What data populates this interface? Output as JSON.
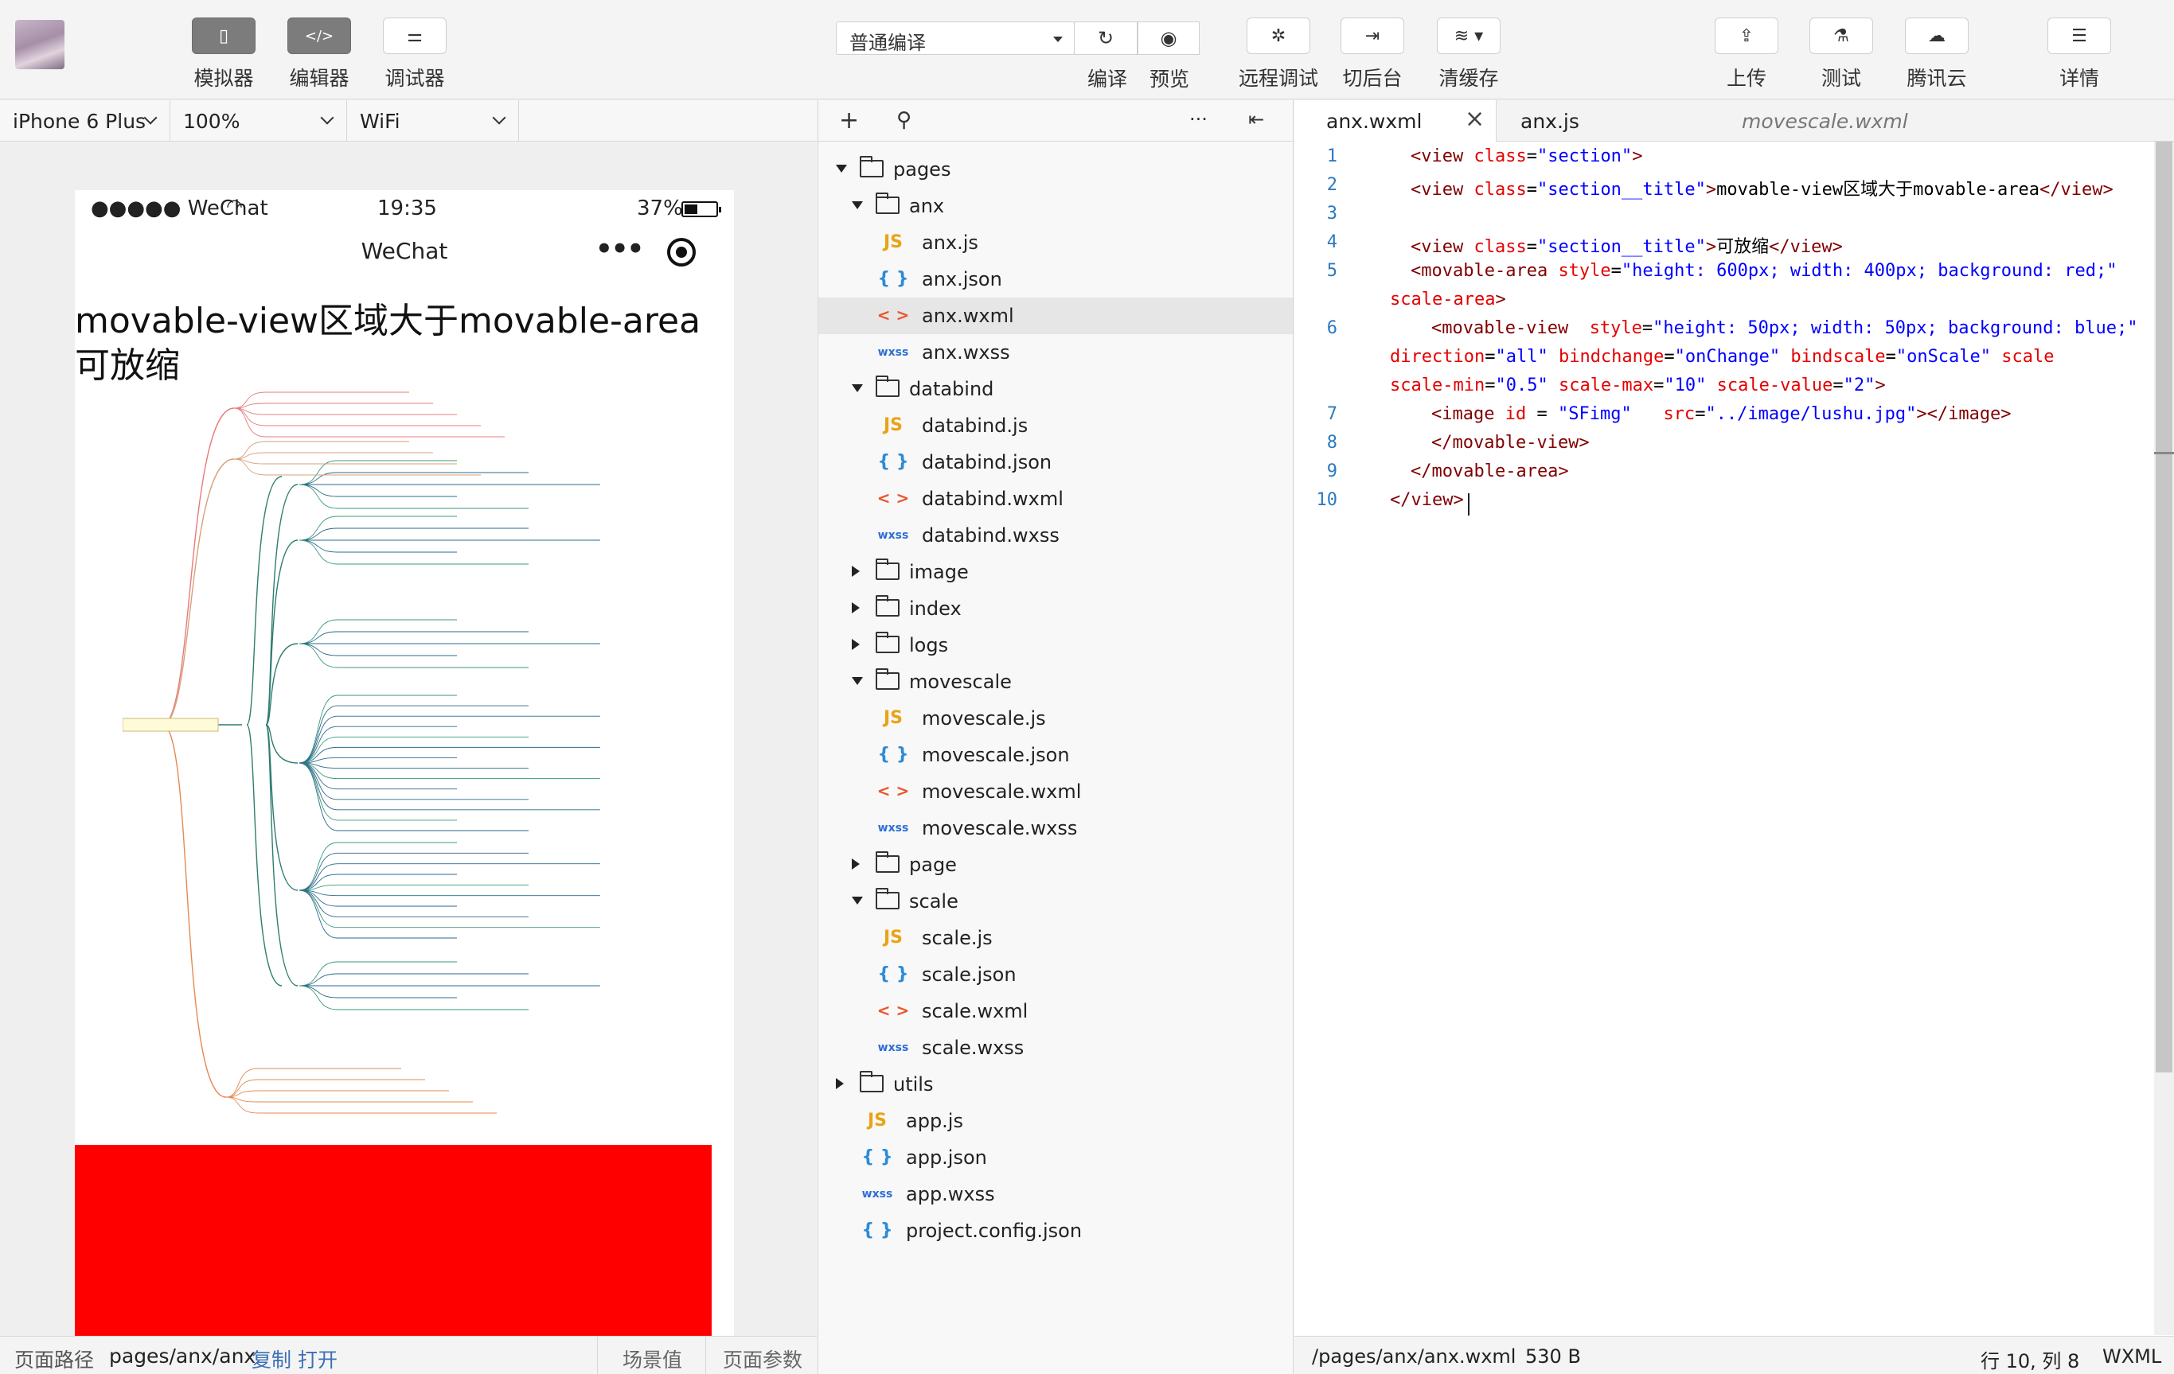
{
  "toolbar": {
    "simulator_label": "模拟器",
    "editor_label": "编辑器",
    "debugger_label": "调试器",
    "compile_mode": "普通编译",
    "compile_label": "编译",
    "preview_label": "预览",
    "remote_debug_label": "远程调试",
    "background_label": "切后台",
    "clear_cache_label": "清缓存",
    "upload_label": "上传",
    "test_label": "测试",
    "tencent_cloud_label": "腾讯云",
    "details_label": "详情"
  },
  "device_bar": {
    "device": "iPhone 6 Plus",
    "zoom": "100%",
    "network": "WiFi"
  },
  "phone": {
    "signal": "●●●●● WeChat",
    "time": "19:35",
    "battery": "37%",
    "nav_title": "WeChat",
    "title_line1": "movable-view区域大于movable-area",
    "title_line2": "可放缩"
  },
  "sim_status": {
    "path_label": "页面路径",
    "path": "pages/anx/anx",
    "copy": "复制",
    "open": "打开",
    "scene": "场景值",
    "params": "页面参数"
  },
  "file_tree": {
    "rows": [
      {
        "label": "pages",
        "kind": "folder",
        "open": true,
        "depth": 0
      },
      {
        "label": "anx",
        "kind": "folder",
        "open": true,
        "depth": 1
      },
      {
        "label": "anx.js",
        "kind": "js",
        "depth": 2
      },
      {
        "label": "anx.json",
        "kind": "json",
        "depth": 2
      },
      {
        "label": "anx.wxml",
        "kind": "wxml",
        "depth": 2,
        "selected": true
      },
      {
        "label": "anx.wxss",
        "kind": "wxss",
        "depth": 2
      },
      {
        "label": "databind",
        "kind": "folder",
        "open": true,
        "depth": 1
      },
      {
        "label": "databind.js",
        "kind": "js",
        "depth": 2
      },
      {
        "label": "databind.json",
        "kind": "json",
        "depth": 2
      },
      {
        "label": "databind.wxml",
        "kind": "wxml",
        "depth": 2
      },
      {
        "label": "databind.wxss",
        "kind": "wxss",
        "depth": 2
      },
      {
        "label": "image",
        "kind": "folder",
        "open": false,
        "depth": 1
      },
      {
        "label": "index",
        "kind": "folder",
        "open": false,
        "depth": 1
      },
      {
        "label": "logs",
        "kind": "folder",
        "open": false,
        "depth": 1
      },
      {
        "label": "movescale",
        "kind": "folder",
        "open": true,
        "depth": 1
      },
      {
        "label": "movescale.js",
        "kind": "js",
        "depth": 2
      },
      {
        "label": "movescale.json",
        "kind": "json",
        "depth": 2
      },
      {
        "label": "movescale.wxml",
        "kind": "wxml",
        "depth": 2
      },
      {
        "label": "movescale.wxss",
        "kind": "wxss",
        "depth": 2
      },
      {
        "label": "page",
        "kind": "folder",
        "open": false,
        "depth": 1
      },
      {
        "label": "scale",
        "kind": "folder",
        "open": true,
        "depth": 1
      },
      {
        "label": "scale.js",
        "kind": "js",
        "depth": 2
      },
      {
        "label": "scale.json",
        "kind": "json",
        "depth": 2
      },
      {
        "label": "scale.wxml",
        "kind": "wxml",
        "depth": 2
      },
      {
        "label": "scale.wxss",
        "kind": "wxss",
        "depth": 2
      },
      {
        "label": "utils",
        "kind": "folder",
        "open": false,
        "depth": 0
      },
      {
        "label": "app.js",
        "kind": "js",
        "depth": 1
      },
      {
        "label": "app.json",
        "kind": "json",
        "depth": 1
      },
      {
        "label": "app.wxss",
        "kind": "wxss",
        "depth": 1
      },
      {
        "label": "project.config.json",
        "kind": "json",
        "depth": 1
      }
    ]
  },
  "editor": {
    "tabs": [
      {
        "label": "anx.wxml",
        "active": true
      },
      {
        "label": "anx.js",
        "active": false
      },
      {
        "label": "movescale.wxml",
        "active": false,
        "preview": true
      }
    ],
    "lines": [
      {
        "n": "1",
        "tokens": [
          [
            "t",
            "<view "
          ],
          [
            "a",
            "class"
          ],
          [
            "x",
            "="
          ],
          [
            "v",
            "\"section\""
          ],
          [
            "t",
            ">"
          ]
        ]
      },
      {
        "n": "2",
        "tokens": [
          [
            "t",
            "<view "
          ],
          [
            "a",
            "class"
          ],
          [
            "x",
            "="
          ],
          [
            "v",
            "\"section__title\""
          ],
          [
            "t",
            ">"
          ],
          [
            "x",
            "movable-view区域大于movable-area"
          ],
          [
            "t",
            "</view>"
          ]
        ]
      },
      {
        "n": "3",
        "tokens": []
      },
      {
        "n": "4",
        "tokens": [
          [
            "t",
            "<view "
          ],
          [
            "a",
            "class"
          ],
          [
            "x",
            "="
          ],
          [
            "v",
            "\"section__title\""
          ],
          [
            "t",
            ">"
          ],
          [
            "x",
            "可放缩"
          ],
          [
            "t",
            "</view>"
          ]
        ]
      },
      {
        "n": "5",
        "tokens": [
          [
            "t",
            "<movable-area "
          ],
          [
            "a",
            "style"
          ],
          [
            "x",
            "="
          ],
          [
            "v",
            "\"height: 600px; width: 400px; background: red;\""
          ]
        ],
        "wrap": [
          [
            "a",
            "scale-area"
          ],
          [
            "t",
            ">"
          ]
        ]
      },
      {
        "n": "6",
        "tokens": [
          [
            "t",
            "<movable-view  "
          ],
          [
            "a",
            "style"
          ],
          [
            "x",
            "="
          ],
          [
            "v",
            "\"height: 50px; width: 50px; background: blue;\""
          ]
        ],
        "wrap": [
          [
            "a",
            "direction"
          ],
          [
            "x",
            "="
          ],
          [
            "v",
            "\"all\" "
          ],
          [
            "a",
            "bindchange"
          ],
          [
            "x",
            "="
          ],
          [
            "v",
            "\"onChange\" "
          ],
          [
            "a",
            "bindscale"
          ],
          [
            "x",
            "="
          ],
          [
            "v",
            "\"onScale\" "
          ],
          [
            "a",
            "scale"
          ]
        ],
        "wrap2": [
          [
            "a",
            "scale-min"
          ],
          [
            "x",
            "="
          ],
          [
            "v",
            "\"0.5\" "
          ],
          [
            "a",
            "scale-max"
          ],
          [
            "x",
            "="
          ],
          [
            "v",
            "\"10\" "
          ],
          [
            "a",
            "scale-value"
          ],
          [
            "x",
            "="
          ],
          [
            "v",
            "\"2\""
          ],
          [
            "t",
            ">"
          ]
        ]
      },
      {
        "n": "7",
        "tokens": [
          [
            "t",
            "<image "
          ],
          [
            "a",
            "id"
          ],
          [
            "x",
            " = "
          ],
          [
            "v",
            "\"SFimg\""
          ],
          [
            "x",
            "   "
          ],
          [
            "a",
            "src"
          ],
          [
            "x",
            "="
          ],
          [
            "v",
            "\"../image/lushu.jpg\""
          ],
          [
            "t",
            "></image>"
          ]
        ]
      },
      {
        "n": "8",
        "tokens": [
          [
            "t",
            "</movable-view>"
          ]
        ]
      },
      {
        "n": "9",
        "tokens": [
          [
            "t",
            "</movable-area>"
          ]
        ]
      },
      {
        "n": "10",
        "tokens": [
          [
            "t",
            "</view>"
          ]
        ]
      }
    ]
  },
  "editor_status": {
    "path": "/pages/anx/anx.wxml",
    "size": "530 B",
    "cursor": "行 10, 列 8",
    "lang": "WXML"
  },
  "colors": {
    "red_area": "#ff0000",
    "tag": "#800000",
    "attr": "#e50000",
    "value": "#0000ff",
    "line_number": "#2b7abf"
  }
}
